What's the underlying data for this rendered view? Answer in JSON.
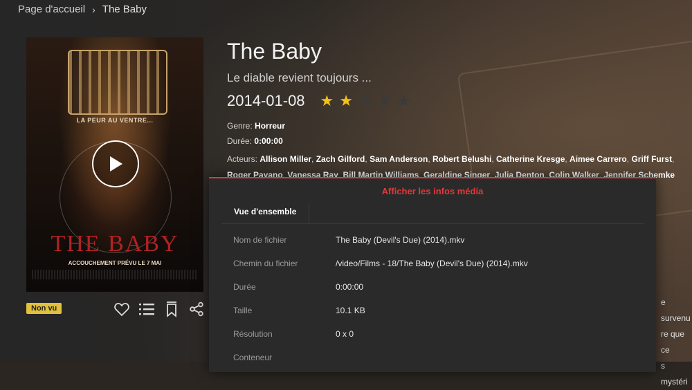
{
  "breadcrumb": {
    "home": "Page d'accueil",
    "current": "The Baby"
  },
  "poster": {
    "tagline": "LA PEUR AU VENTRE...",
    "title": "THE BABY",
    "subtitle": "ACCOUCHEMENT PRÉVU LE 7 MAI"
  },
  "badge": {
    "label": "Non vu"
  },
  "movie": {
    "title": "The Baby",
    "tagline": "Le diable revient toujours ...",
    "date": "2014-01-08",
    "rating_stars": 2,
    "rating_max": 5,
    "genre_label": "Genre:",
    "genre": "Horreur",
    "duration_label": "Durée:",
    "duration": "0:00:00",
    "actors_label": "Acteurs:",
    "actors_line1": [
      "Allison Miller",
      "Zach Gilford",
      "Sam Anderson",
      "Robert Belushi",
      "Catherine Kresge",
      "Aimee Carrero",
      "Griff Furst"
    ],
    "actors_line2": [
      "Roger Payano",
      "Vanessa Ray",
      "Bill Martin Williams",
      "Geraldine Singer",
      "Julia Denton",
      "Colin Walker",
      "Jennifer Schemke"
    ]
  },
  "side_text": [
    "e survenu",
    "re que ce",
    "s mystéri"
  ],
  "dialog": {
    "title": "Afficher les infos média",
    "tab": "Vue d'ensemble",
    "rows": [
      {
        "key": "Nom de fichier",
        "value": "The Baby (Devil's Due) (2014).mkv"
      },
      {
        "key": "Chemin du fichier",
        "value": "/video/Films - 18/The Baby (Devil's Due) (2014).mkv"
      },
      {
        "key": "Durée",
        "value": "0:00:00"
      },
      {
        "key": "Taille",
        "value": "10.1 KB"
      },
      {
        "key": "Résolution",
        "value": "0 x 0"
      },
      {
        "key": "Conteneur",
        "value": ""
      }
    ]
  },
  "colors": {
    "accent": "#e03a3a",
    "star": "#f1c21a",
    "badge": "#e1c03b"
  }
}
